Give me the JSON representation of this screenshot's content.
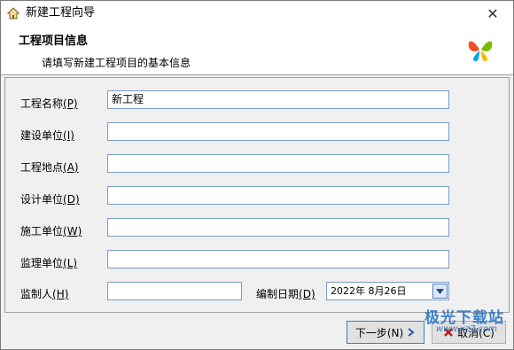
{
  "window": {
    "title": "新建工程向导"
  },
  "header": {
    "title": "工程项目信息",
    "subtitle": "请填写新建工程项目的基本信息"
  },
  "fields": [
    {
      "label": "工程名称",
      "hotkey": "(P)",
      "value": "新工程"
    },
    {
      "label": "建设单位",
      "hotkey": "(I)",
      "value": ""
    },
    {
      "label": "工程地点",
      "hotkey": "(A)",
      "value": ""
    },
    {
      "label": "设计单位",
      "hotkey": "(D)",
      "value": ""
    },
    {
      "label": "施工单位",
      "hotkey": "(W)",
      "value": ""
    },
    {
      "label": "监理单位",
      "hotkey": "(L)",
      "value": ""
    },
    {
      "label": "监制人",
      "hotkey": "(H)",
      "value": ""
    }
  ],
  "date": {
    "label": "编制日期",
    "hotkey": "(D)",
    "value": "2022年  8月26日"
  },
  "buttons": {
    "next": "下一步(N)",
    "cancel": "取消(C)"
  },
  "watermark": {
    "text": "极光下载站",
    "url": "www.xz7.com"
  },
  "icons": {
    "title": "house-icon",
    "close": "close-icon",
    "logo": "butterfly-logo-icon",
    "next": "arrow-right-icon",
    "cancel": "red-x-icon",
    "date": "dropdown-arrow-icon"
  }
}
